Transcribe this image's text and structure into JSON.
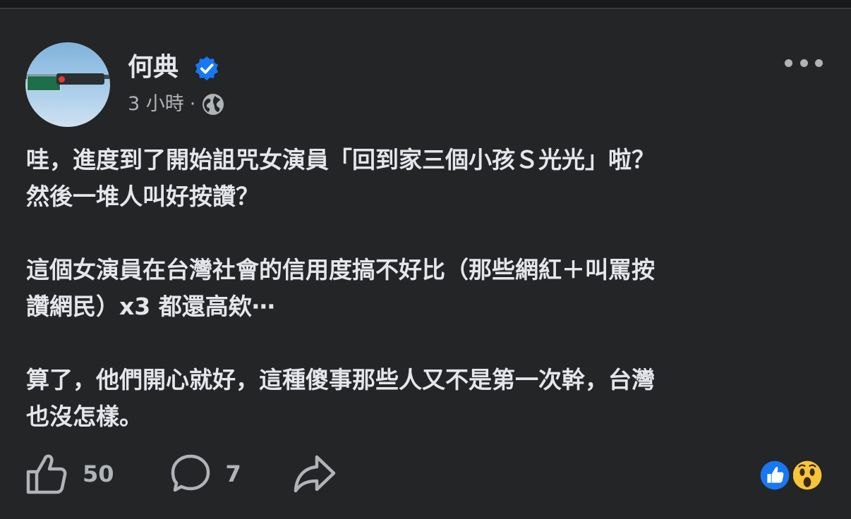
{
  "post": {
    "author": "何典",
    "time": "3 小時",
    "separator": "·",
    "paragraphs": [
      [
        "哇，進度到了開始詛咒女演員「回到家三個小孩Ｓ光光」啦？",
        "然後一堆人叫好按讚？"
      ],
      [
        "這個女演員在台灣社會的信用度搞不好比（那些網紅＋叫罵按",
        "讚網民）x3 都還高欸⋯"
      ],
      [
        "算了，他們開心就好，這種傻事那些人又不是第一次幹，台灣",
        "也沒怎樣。"
      ]
    ],
    "likes": "50",
    "comments": "7"
  },
  "icons": {
    "verified": "verified-badge-icon",
    "privacy": "globe-icon",
    "more": "more-options-icon",
    "like": "thumbs-up-icon",
    "comment": "comment-bubble-icon",
    "share": "share-arrow-icon",
    "reaction_like": "like-reaction-icon",
    "reaction_wow": "wow-reaction-icon"
  },
  "colors": {
    "background": "#242526",
    "text": "#e4e6eb",
    "secondary": "#b0b3b8",
    "verified_blue": "#1877f2",
    "wow_yellow": "#f7c53a"
  }
}
